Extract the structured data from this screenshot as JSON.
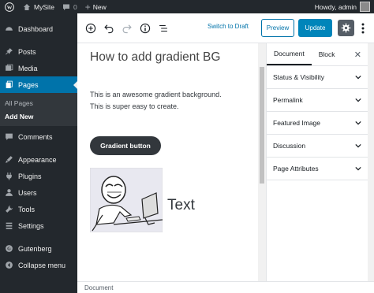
{
  "admin_bar": {
    "site_name": "MySite",
    "comments_count": "0",
    "new_label": "New",
    "greeting": "Howdy, admin"
  },
  "sidebar": {
    "items": [
      {
        "label": "Dashboard",
        "icon": "dashboard-icon"
      },
      {
        "label": "Posts",
        "icon": "pin-icon"
      },
      {
        "label": "Media",
        "icon": "media-icon"
      },
      {
        "label": "Pages",
        "icon": "pages-icon"
      },
      {
        "label": "Comments",
        "icon": "comment-icon"
      },
      {
        "label": "Appearance",
        "icon": "appearance-icon"
      },
      {
        "label": "Plugins",
        "icon": "plugin-icon"
      },
      {
        "label": "Users",
        "icon": "users-icon"
      },
      {
        "label": "Tools",
        "icon": "tools-icon"
      },
      {
        "label": "Settings",
        "icon": "settings-icon"
      },
      {
        "label": "Gutenberg",
        "icon": "gutenberg-icon"
      },
      {
        "label": "Collapse menu",
        "icon": "collapse-icon"
      }
    ],
    "pages_submenu": [
      "All Pages",
      "Add New"
    ]
  },
  "toolbar": {
    "switch_to_draft": "Switch to Draft",
    "preview": "Preview",
    "update": "Update"
  },
  "content": {
    "title": "How to add gradient BG",
    "paragraph_1": "This is an awesome gradient background.",
    "paragraph_2": "This is super easy to create.",
    "button_label": "Gradient button",
    "media_text": "Text"
  },
  "panel": {
    "tabs": [
      "Document",
      "Block"
    ],
    "sections": [
      "Status & Visibility",
      "Permalink",
      "Featured Image",
      "Discussion",
      "Page Attributes"
    ]
  },
  "footer": {
    "breadcrumb": "Document"
  },
  "colors": {
    "admin_dark": "#23282d",
    "accent": "#0073aa",
    "update_blue": "#0085ba",
    "button_dark": "#32373c"
  }
}
